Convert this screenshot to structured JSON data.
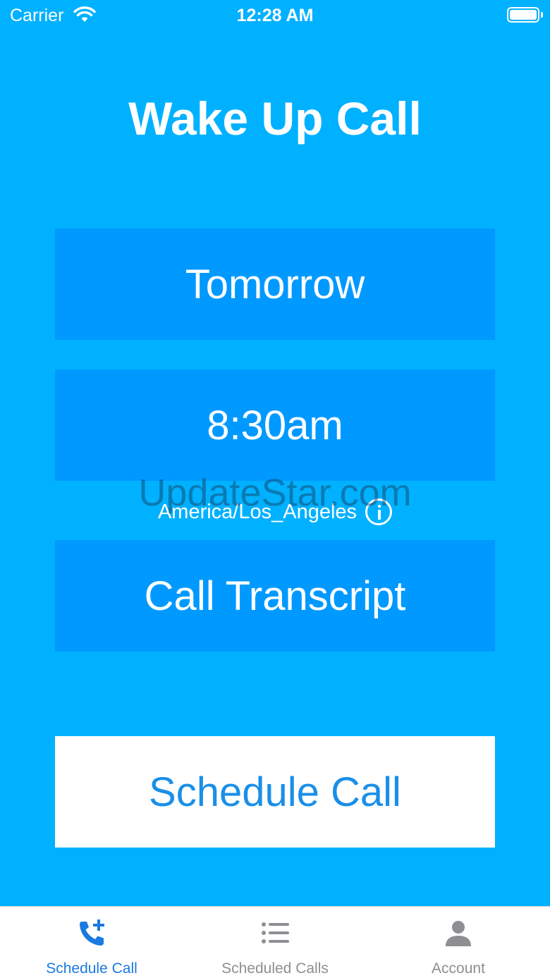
{
  "status_bar": {
    "carrier": "Carrier",
    "time": "12:28 AM"
  },
  "title": "Wake Up Call",
  "fields": {
    "date": "Tomorrow",
    "time": "8:30am",
    "timezone": "America/Los_Angeles",
    "transcript": "Call Transcript"
  },
  "watermark": "UpdateStar.com",
  "actions": {
    "schedule_label": "Schedule Call"
  },
  "tabs": [
    {
      "label": "Schedule Call",
      "icon": "phone-plus-icon",
      "active": true
    },
    {
      "label": "Scheduled Calls",
      "icon": "list-icon",
      "active": false
    },
    {
      "label": "Account",
      "icon": "person-icon",
      "active": false
    }
  ],
  "colors": {
    "background": "#00b1ff",
    "field": "#0099ff",
    "accent": "#1a7ae0",
    "inactive": "#8e8e93"
  }
}
